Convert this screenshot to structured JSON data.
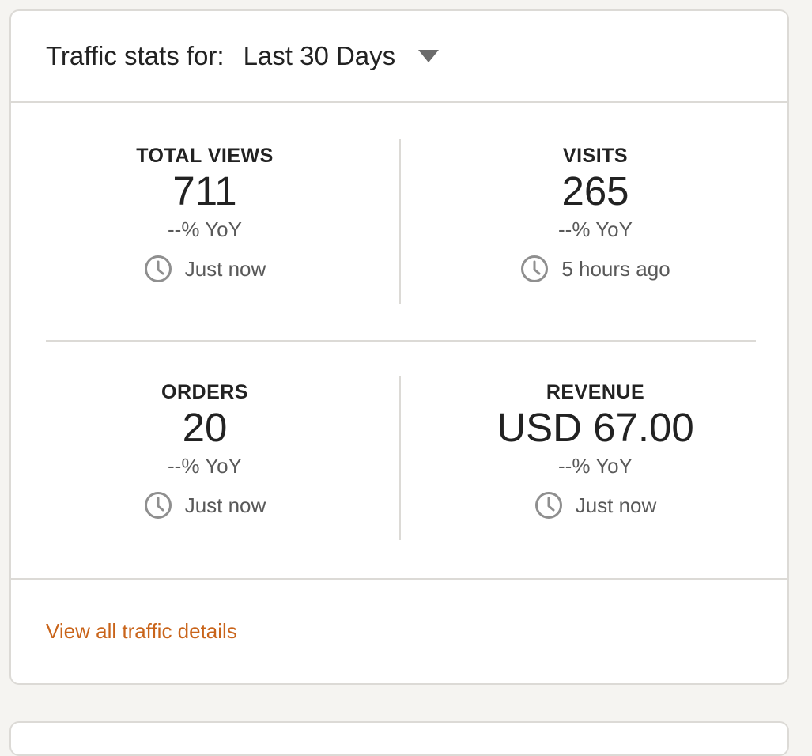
{
  "header": {
    "label": "Traffic stats for:",
    "period": "Last 30 Days"
  },
  "stats": [
    {
      "label": "TOTAL VIEWS",
      "value": "711",
      "yoy": "--% YoY",
      "updated": "Just now"
    },
    {
      "label": "VISITS",
      "value": "265",
      "yoy": "--% YoY",
      "updated": "5 hours ago"
    },
    {
      "label": "ORDERS",
      "value": "20",
      "yoy": "--% YoY",
      "updated": "Just now"
    },
    {
      "label": "REVENUE",
      "value": "USD 67.00",
      "yoy": "--% YoY",
      "updated": "Just now"
    }
  ],
  "footer": {
    "link_label": "View all traffic details"
  },
  "icons": {
    "caret": "caret-down-icon",
    "clock": "clock-icon"
  },
  "colors": {
    "link": "#c9641a",
    "border": "#dcdad6",
    "background": "#f5f4f1",
    "icon_gray": "#8f8f8f"
  }
}
